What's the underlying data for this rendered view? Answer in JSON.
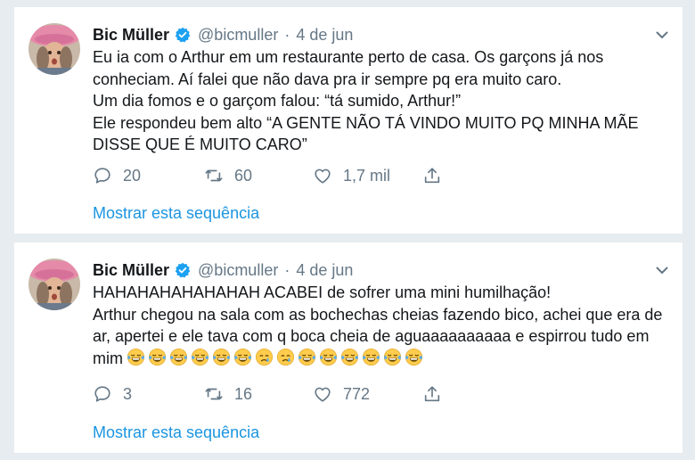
{
  "colors": {
    "background": "#e6ecf0",
    "card": "#ffffff",
    "text": "#14171a",
    "muted": "#657786",
    "link": "#1b95e0",
    "verified": "#1da1f2"
  },
  "tweets": [
    {
      "author": {
        "name": "Bic Müller",
        "handle": "@bicmuller",
        "verified": true,
        "avatar_icon": "user-avatar-photo"
      },
      "separator": "·",
      "date": "4 de jun",
      "menu_icon": "chevron-down-icon",
      "lines": [
        "Eu ia com o Arthur em um restaurante perto de casa. Os garçons já nos conheciam. Aí falei que não dava pra ir sempre pq era muito caro.",
        "Um dia fomos e o garçom falou: “tá sumido, Arthur!”",
        "Ele respondeu bem alto “A GENTE NÃO TÁ VINDO MUITO PQ MINHA MÃE DISSE QUE É MUITO CARO”"
      ],
      "emojis": [],
      "actions": {
        "replies": "20",
        "retweets": "60",
        "likes": "1,7 mil"
      },
      "thread_link": "Mostrar esta sequência"
    },
    {
      "author": {
        "name": "Bic Müller",
        "handle": "@bicmuller",
        "verified": true,
        "avatar_icon": "user-avatar-photo"
      },
      "separator": "·",
      "date": "4 de jun",
      "menu_icon": "chevron-down-icon",
      "lines": [
        "HAHAHAHAHAHAHAH ACABEI de sofrer uma mini humilhação!",
        "Arthur chegou na sala com as bochechas cheias fazendo bico, achei que era de ar, apertei e ele tava com q boca cheia de aguaaaaaaaaaa e espirrou tudo em mim"
      ],
      "emojis": [
        "😂",
        "😂",
        "😂",
        "😂",
        "😂",
        "😂",
        "😢",
        "😢",
        "😂",
        "😂",
        "😂",
        "😂",
        "😂",
        "😂"
      ],
      "actions": {
        "replies": "3",
        "retweets": "16",
        "likes": "772"
      },
      "thread_link": "Mostrar esta sequência"
    }
  ]
}
